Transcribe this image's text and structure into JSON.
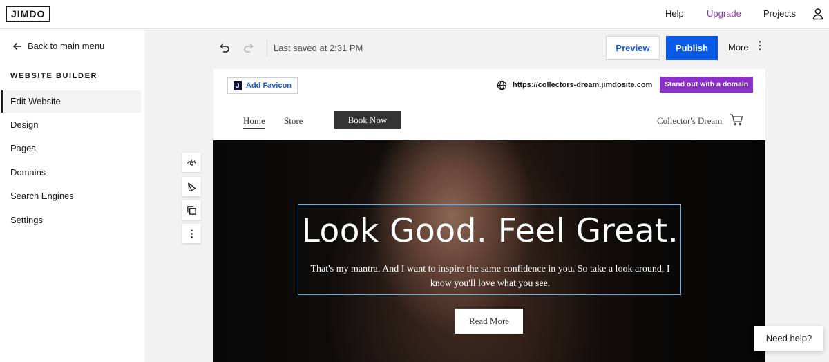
{
  "topbar": {
    "logo": "JIMDO",
    "help": "Help",
    "upgrade": "Upgrade",
    "projects": "Projects",
    "user_icon": "user-icon"
  },
  "sidebar": {
    "back_label": "Back to main menu",
    "section_title": "WEBSITE BUILDER",
    "items": [
      {
        "label": "Edit Website",
        "active": true
      },
      {
        "label": "Design"
      },
      {
        "label": "Pages"
      },
      {
        "label": "Domains"
      },
      {
        "label": "Search Engines"
      },
      {
        "label": "Settings"
      }
    ]
  },
  "toolbar": {
    "saved_text": "Last saved at 2:31 PM",
    "preview_label": "Preview",
    "publish_label": "Publish",
    "more_label": "More"
  },
  "site": {
    "favicon_label": "Add Favicon",
    "favicon_letter": "J",
    "url": "https://collectors-dream.jimdosite.com",
    "domain_button": "Stand out with a domain",
    "nav": {
      "home": "Home",
      "store": "Store",
      "book_now": "Book Now"
    },
    "site_name": "Collector's Dream"
  },
  "hero": {
    "title": "Look Good. Feel Great.",
    "subtitle": "That's my mantra. And I want to inspire the same confidence in you. So take a look around, I know you'll love what you see.",
    "button": "Read More"
  },
  "help_widget": {
    "label": "Need help?"
  },
  "colors": {
    "accent_blue": "#0a5ae8",
    "upgrade_purple": "#8a3bb5",
    "domain_purple": "#8b2fc9"
  }
}
